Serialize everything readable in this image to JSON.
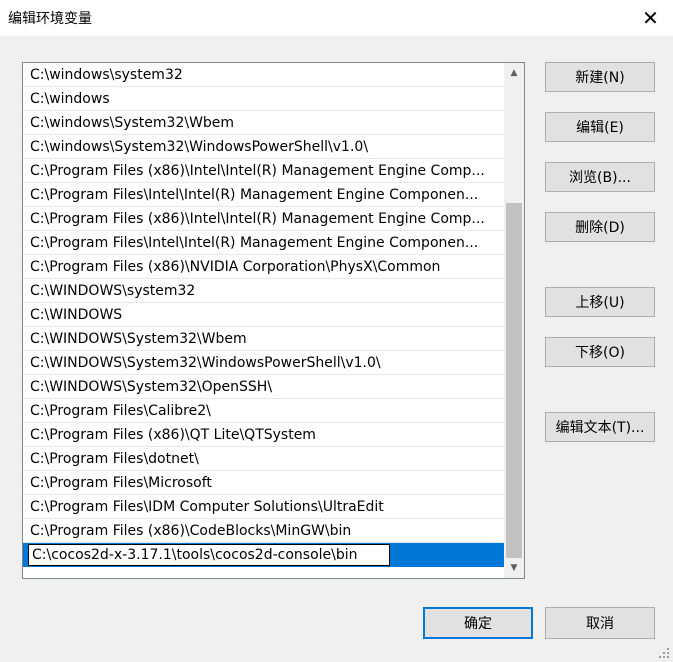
{
  "window": {
    "title": "编辑环境变量",
    "close_label": "✕"
  },
  "list": {
    "items": [
      "C:\\windows\\system32",
      "C:\\windows",
      "C:\\windows\\System32\\Wbem",
      "C:\\windows\\System32\\WindowsPowerShell\\v1.0\\",
      "C:\\Program Files (x86)\\Intel\\Intel(R) Management Engine Comp...",
      "C:\\Program Files\\Intel\\Intel(R) Management Engine Componen...",
      "C:\\Program Files (x86)\\Intel\\Intel(R) Management Engine Comp...",
      "C:\\Program Files\\Intel\\Intel(R) Management Engine Componen...",
      "C:\\Program Files (x86)\\NVIDIA Corporation\\PhysX\\Common",
      "C:\\WINDOWS\\system32",
      "C:\\WINDOWS",
      "C:\\WINDOWS\\System32\\Wbem",
      "C:\\WINDOWS\\System32\\WindowsPowerShell\\v1.0\\",
      "C:\\WINDOWS\\System32\\OpenSSH\\",
      "C:\\Program Files\\Calibre2\\",
      "C:\\Program Files (x86)\\QT Lite\\QTSystem",
      "C:\\Program Files\\dotnet\\",
      "C:\\Program Files\\Microsoft",
      "C:\\Program Files\\IDM Computer Solutions\\UltraEdit",
      "C:\\Program Files (x86)\\CodeBlocks\\MinGW\\bin"
    ],
    "editing_value": "C:\\cocos2d-x-3.17.1\\tools\\cocos2d-console\\bin",
    "scroll_up_icon": "▲",
    "scroll_down_icon": "▼"
  },
  "buttons": {
    "new": "新建(N)",
    "edit": "编辑(E)",
    "browse": "浏览(B)...",
    "delete": "删除(D)",
    "move_up": "上移(U)",
    "move_down": "下移(O)",
    "edit_text": "编辑文本(T)..."
  },
  "footer": {
    "ok": "确定",
    "cancel": "取消"
  },
  "colors": {
    "selection": "#0078d7",
    "default_button_border": "#0078d7"
  }
}
